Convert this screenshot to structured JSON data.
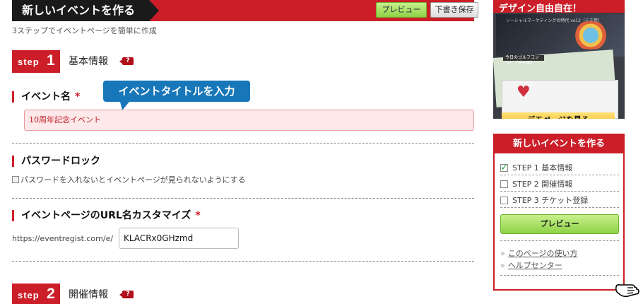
{
  "header": {
    "title": "新しいイベントを作る",
    "preview_label": "プレビュー",
    "draft_label": "下書き保存",
    "subtitle": "3ステップでイベントページを簡単に作成"
  },
  "step1": {
    "word": "step",
    "number": "1",
    "title": "基本情報",
    "help_text": "?"
  },
  "event_name": {
    "label": "イベント名",
    "required_mark": "*",
    "value": "10周年記念イベント",
    "tooltip": "イベントタイトルを入力"
  },
  "password": {
    "label": "パスワードロック",
    "checkbox_label": "パスワードを入れないとイベントページが見られないようにする"
  },
  "url": {
    "label": "イベントページのURL名カスタマイズ",
    "required_mark": "*",
    "prefix": "https://eventregist.com/e/",
    "value": "KLACRx0GHzmd"
  },
  "step2": {
    "word": "step",
    "number": "2",
    "title": "開催情報",
    "help_text": "?"
  },
  "banner": {
    "title": "デザイン自由自在！",
    "screenshot_caption": "ソーシャルマーケティングの時代 vol.2（デモ用）",
    "screenshot_caption2": "今日のゴルフコンペ！（デモ用）",
    "demo_button": "デモページを見る"
  },
  "panel": {
    "title": "新しいイベントを作る",
    "steps": [
      {
        "label": "STEP 1 基本情報",
        "checked": true
      },
      {
        "label": "STEP 2 開催情報",
        "checked": false
      },
      {
        "label": "STEP 3 チケット登録",
        "checked": false
      }
    ],
    "preview_label": "プレビュー",
    "links": [
      {
        "arrow": "»",
        "label": "このページの使い方"
      },
      {
        "arrow": "»",
        "label": "ヘルプセンター"
      }
    ]
  },
  "colors": {
    "accent": "#cc1e28",
    "tooltip": "#1877b9",
    "preview_green": "#8ed246",
    "demo_yellow": "#f1b61a"
  }
}
